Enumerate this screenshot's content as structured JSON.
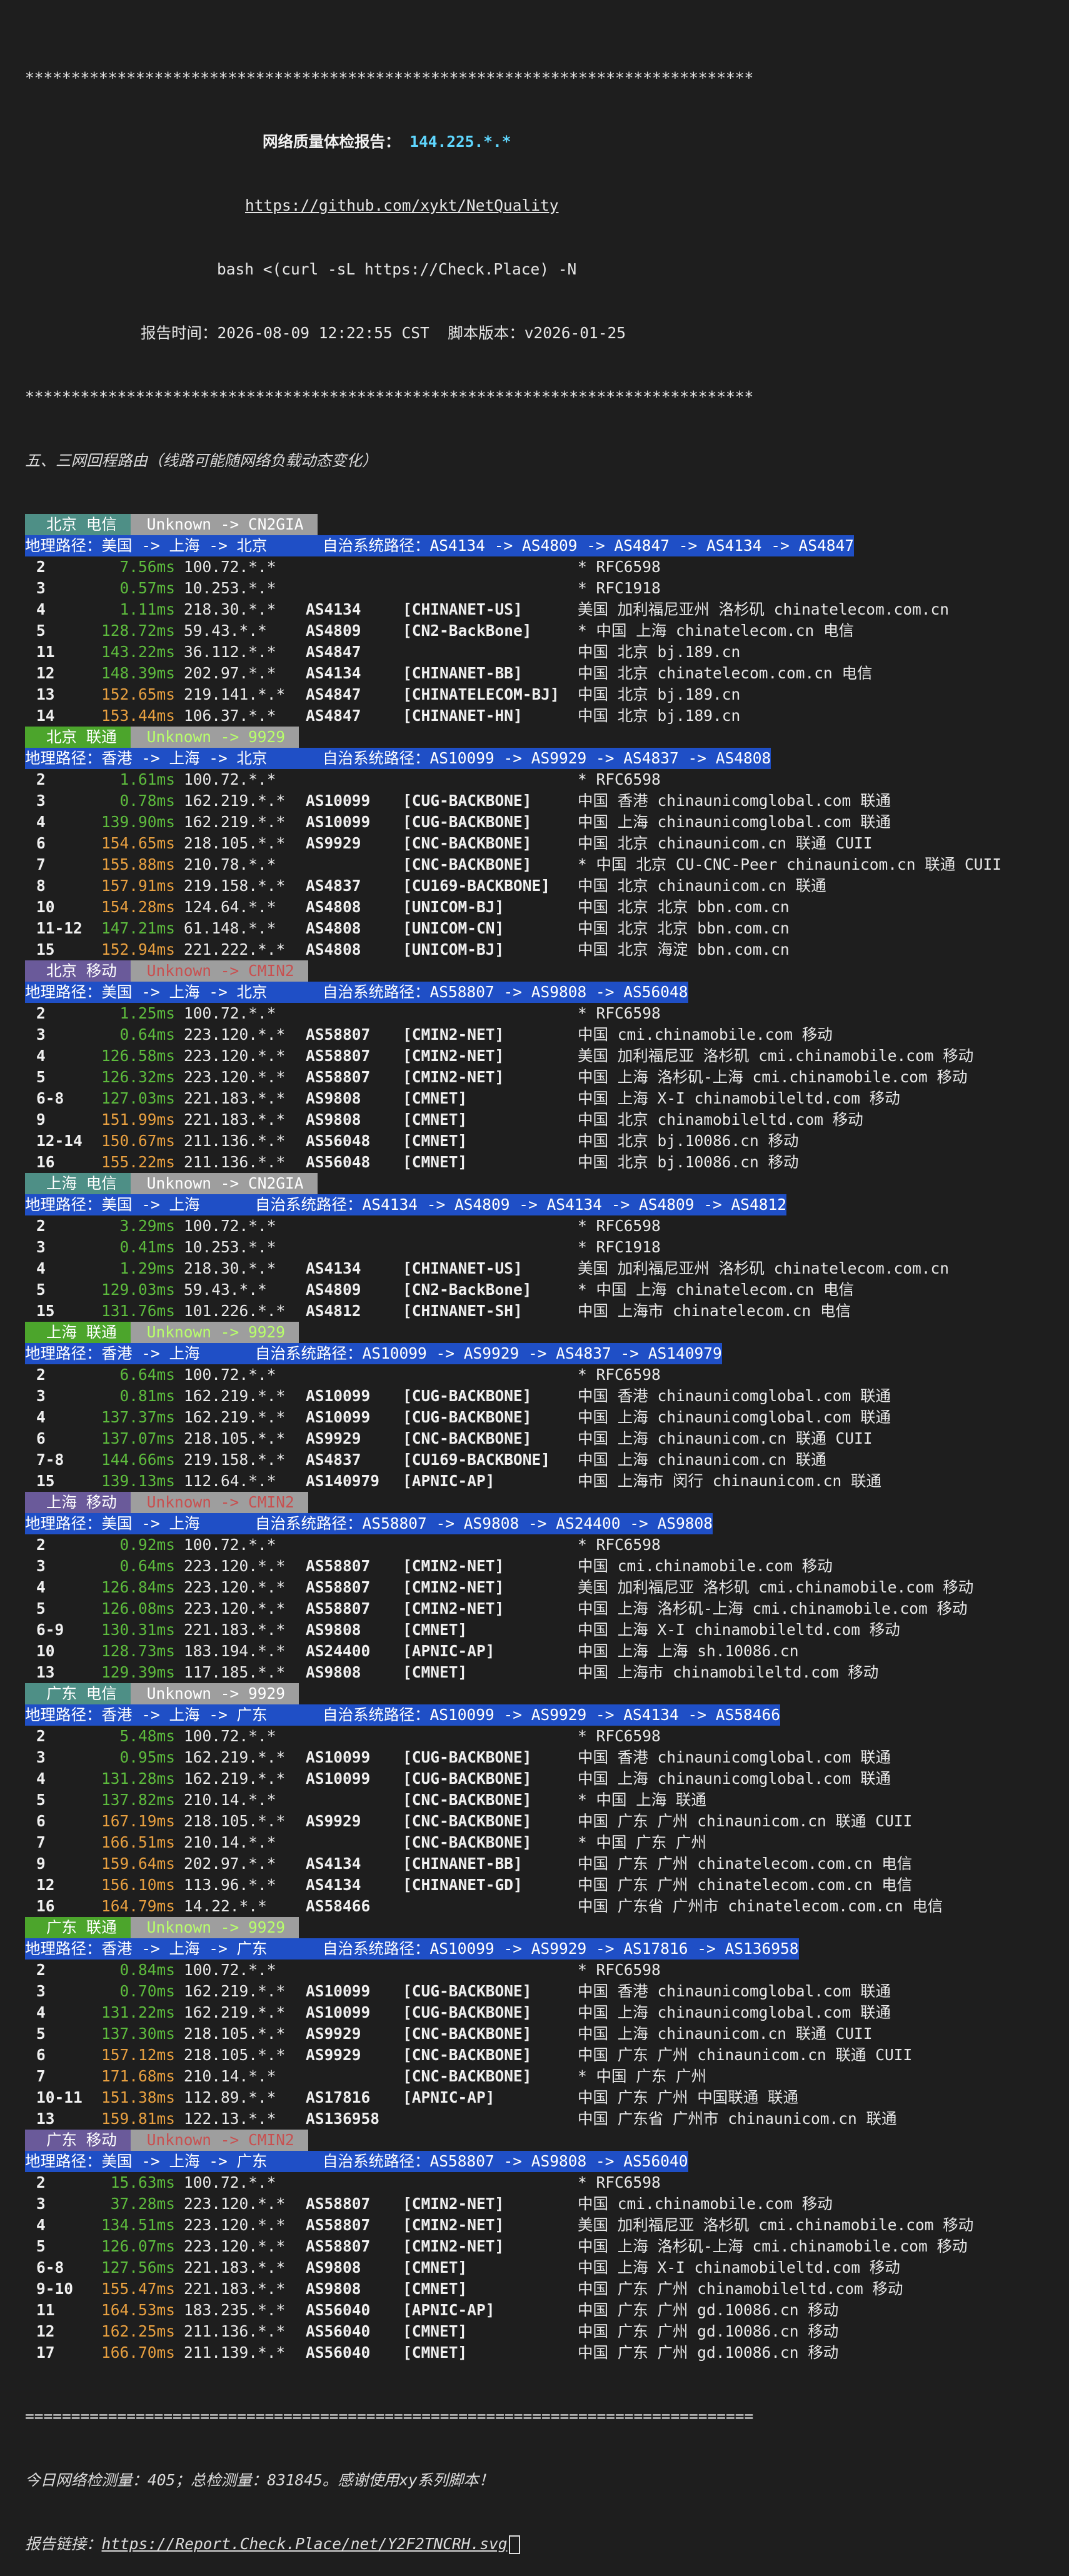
{
  "header": {
    "stars": "*******************************************************************************",
    "title_label": "网络质量体检报告：",
    "title_ip": "144.225.*.*",
    "url": "https://github.com/xykt/NetQuality",
    "command": "bash <(curl -sL https://Check.Place) -N",
    "report_time": "报告时间：2026-08-09 12:22:55 CST  脚本版本：v2026-01-25"
  },
  "section_title": "五、三网回程路由（线路可能随网络负载动态变化）",
  "routes": [
    {
      "city": "北京",
      "isp": "电信",
      "lbl_color": "#4e8f86",
      "tag": "Unknown -> CN2GIA",
      "tag_style": "plain",
      "path": "地理路径：美国 -> 上海 -> 北京      自治系统路径：AS4134 -> AS4809 -> AS4847 -> AS4134 -> AS4847",
      "hops": [
        {
          "hop": "2",
          "ms": "7.56ms",
          "msc": "#5dbb3d",
          "ip": "100.72.*.*",
          "as": "",
          "tag": "",
          "geo": "* RFC6598"
        },
        {
          "hop": "3",
          "ms": "0.57ms",
          "msc": "#5dbb3d",
          "ip": "10.253.*.*",
          "as": "",
          "tag": "",
          "geo": "* RFC1918"
        },
        {
          "hop": "4",
          "ms": "1.11ms",
          "msc": "#5dbb3d",
          "ip": "218.30.*.*",
          "as": "AS4134",
          "tag": "[CHINANET-US]",
          "geo": "美国 加利福尼亚州 洛杉矶 chinatelecom.com.cn"
        },
        {
          "hop": "5",
          "ms": "128.72ms",
          "msc": "#5dbb3d",
          "ip": "59.43.*.*",
          "as": "AS4809",
          "tag": "[CN2-BackBone]",
          "geo": "* 中国 上海 chinatelecom.cn 电信"
        },
        {
          "hop": "11",
          "ms": "143.22ms",
          "msc": "#5dbb3d",
          "ip": "36.112.*.*",
          "as": "AS4847",
          "tag": "",
          "geo": "中国 北京 bj.189.cn"
        },
        {
          "hop": "12",
          "ms": "148.39ms",
          "msc": "#5dbb3d",
          "ip": "202.97.*.*",
          "as": "AS4134",
          "tag": "[CHINANET-BB]",
          "geo": "中国 北京 chinatelecom.com.cn 电信"
        },
        {
          "hop": "13",
          "ms": "152.65ms",
          "msc": "#e8a040",
          "ip": "219.141.*.*",
          "as": "AS4847",
          "tag": "[CHINATELECOM-BJ]",
          "geo": "中国 北京 bj.189.cn"
        },
        {
          "hop": "14",
          "ms": "153.44ms",
          "msc": "#e8a040",
          "ip": "106.37.*.*",
          "as": "AS4847",
          "tag": "[CHINANET-HN]",
          "geo": "中国 北京 bj.189.cn"
        }
      ]
    },
    {
      "city": "北京",
      "isp": "联通",
      "lbl_color": "#4ca52c",
      "tag": "Unknown -> 9929",
      "tag_style": "green",
      "path": "地理路径：香港 -> 上海 -> 北京      自治系统路径：AS10099 -> AS9929 -> AS4837 -> AS4808",
      "hops": [
        {
          "hop": "2",
          "ms": "1.61ms",
          "msc": "#5dbb3d",
          "ip": "100.72.*.*",
          "as": "",
          "tag": "",
          "geo": "* RFC6598"
        },
        {
          "hop": "3",
          "ms": "0.78ms",
          "msc": "#5dbb3d",
          "ip": "162.219.*.*",
          "as": "AS10099",
          "tag": "[CUG-BACKBONE]",
          "geo": "中国 香港 chinaunicomglobal.com 联通"
        },
        {
          "hop": "4",
          "ms": "139.90ms",
          "msc": "#5dbb3d",
          "ip": "162.219.*.*",
          "as": "AS10099",
          "tag": "[CUG-BACKBONE]",
          "geo": "中国 上海 chinaunicomglobal.com 联通"
        },
        {
          "hop": "6",
          "ms": "154.65ms",
          "msc": "#e8a040",
          "ip": "218.105.*.*",
          "as": "AS9929",
          "tag": "[CNC-BACKBONE]",
          "geo": "中国 北京 chinaunicom.cn 联通 CUII"
        },
        {
          "hop": "7",
          "ms": "155.88ms",
          "msc": "#e8a040",
          "ip": "210.78.*.*",
          "as": "",
          "tag": "[CNC-BACKBONE]",
          "geo": "* 中国 北京 CU-CNC-Peer chinaunicom.cn 联通 CUII"
        },
        {
          "hop": "8",
          "ms": "157.91ms",
          "msc": "#e8a040",
          "ip": "219.158.*.*",
          "as": "AS4837",
          "tag": "[CU169-BACKBONE]",
          "geo": "中国 北京 chinaunicom.cn 联通"
        },
        {
          "hop": "10",
          "ms": "154.28ms",
          "msc": "#e8a040",
          "ip": "124.64.*.*",
          "as": "AS4808",
          "tag": "[UNICOM-BJ]",
          "geo": "中国 北京 北京 bbn.com.cn"
        },
        {
          "hop": "11-12",
          "ms": "147.21ms",
          "msc": "#5dbb3d",
          "ip": "61.148.*.*",
          "as": "AS4808",
          "tag": "[UNICOM-CN]",
          "geo": "中国 北京 北京 bbn.com.cn"
        },
        {
          "hop": "15",
          "ms": "152.94ms",
          "msc": "#e8a040",
          "ip": "221.222.*.*",
          "as": "AS4808",
          "tag": "[UNICOM-BJ]",
          "geo": "中国 北京 海淀 bbn.com.cn"
        }
      ]
    },
    {
      "city": "北京",
      "isp": "移动",
      "lbl_color": "#6a5a9a",
      "tag": "Unknown -> CMIN2",
      "tag_style": "red",
      "path": "地理路径：美国 -> 上海 -> 北京      自治系统路径：AS58807 -> AS9808 -> AS56048",
      "hops": [
        {
          "hop": "2",
          "ms": "1.25ms",
          "msc": "#5dbb3d",
          "ip": "100.72.*.*",
          "as": "",
          "tag": "",
          "geo": "* RFC6598"
        },
        {
          "hop": "3",
          "ms": "0.64ms",
          "msc": "#5dbb3d",
          "ip": "223.120.*.*",
          "as": "AS58807",
          "tag": "[CMIN2-NET]",
          "geo": "中国 cmi.chinamobile.com 移动"
        },
        {
          "hop": "4",
          "ms": "126.58ms",
          "msc": "#5dbb3d",
          "ip": "223.120.*.*",
          "as": "AS58807",
          "tag": "[CMIN2-NET]",
          "geo": "美国 加利福尼亚 洛杉矶 cmi.chinamobile.com 移动"
        },
        {
          "hop": "5",
          "ms": "126.32ms",
          "msc": "#5dbb3d",
          "ip": "223.120.*.*",
          "as": "AS58807",
          "tag": "[CMIN2-NET]",
          "geo": "中国 上海 洛杉矶-上海 cmi.chinamobile.com 移动"
        },
        {
          "hop": "6-8",
          "ms": "127.03ms",
          "msc": "#5dbb3d",
          "ip": "221.183.*.*",
          "as": "AS9808",
          "tag": "[CMNET]",
          "geo": "中国 上海 X-I chinamobileltd.com 移动"
        },
        {
          "hop": "9",
          "ms": "151.99ms",
          "msc": "#e8a040",
          "ip": "221.183.*.*",
          "as": "AS9808",
          "tag": "[CMNET]",
          "geo": "中国 北京 chinamobileltd.com 移动"
        },
        {
          "hop": "12-14",
          "ms": "150.67ms",
          "msc": "#e8a040",
          "ip": "211.136.*.*",
          "as": "AS56048",
          "tag": "[CMNET]",
          "geo": "中国 北京 bj.10086.cn 移动"
        },
        {
          "hop": "16",
          "ms": "155.22ms",
          "msc": "#e8a040",
          "ip": "211.136.*.*",
          "as": "AS56048",
          "tag": "[CMNET]",
          "geo": "中国 北京 bj.10086.cn 移动"
        }
      ]
    },
    {
      "city": "上海",
      "isp": "电信",
      "lbl_color": "#4e8f86",
      "tag": "Unknown -> CN2GIA",
      "tag_style": "plain",
      "path": "地理路径：美国 -> 上海      自治系统路径：AS4134 -> AS4809 -> AS4134 -> AS4809 -> AS4812",
      "hops": [
        {
          "hop": "2",
          "ms": "3.29ms",
          "msc": "#5dbb3d",
          "ip": "100.72.*.*",
          "as": "",
          "tag": "",
          "geo": "* RFC6598"
        },
        {
          "hop": "3",
          "ms": "0.41ms",
          "msc": "#5dbb3d",
          "ip": "10.253.*.*",
          "as": "",
          "tag": "",
          "geo": "* RFC1918"
        },
        {
          "hop": "4",
          "ms": "1.29ms",
          "msc": "#5dbb3d",
          "ip": "218.30.*.*",
          "as": "AS4134",
          "tag": "[CHINANET-US]",
          "geo": "美国 加利福尼亚州 洛杉矶 chinatelecom.com.cn"
        },
        {
          "hop": "5",
          "ms": "129.03ms",
          "msc": "#5dbb3d",
          "ip": "59.43.*.*",
          "as": "AS4809",
          "tag": "[CN2-BackBone]",
          "geo": "* 中国 上海 chinatelecom.cn 电信"
        },
        {
          "hop": "15",
          "ms": "131.76ms",
          "msc": "#5dbb3d",
          "ip": "101.226.*.*",
          "as": "AS4812",
          "tag": "[CHINANET-SH]",
          "geo": "中国 上海市 chinatelecom.cn 电信"
        }
      ]
    },
    {
      "city": "上海",
      "isp": "联通",
      "lbl_color": "#4ca52c",
      "tag": "Unknown -> 9929",
      "tag_style": "green",
      "path": "地理路径：香港 -> 上海      自治系统路径：AS10099 -> AS9929 -> AS4837 -> AS140979",
      "hops": [
        {
          "hop": "2",
          "ms": "6.64ms",
          "msc": "#5dbb3d",
          "ip": "100.72.*.*",
          "as": "",
          "tag": "",
          "geo": "* RFC6598"
        },
        {
          "hop": "3",
          "ms": "0.81ms",
          "msc": "#5dbb3d",
          "ip": "162.219.*.*",
          "as": "AS10099",
          "tag": "[CUG-BACKBONE]",
          "geo": "中国 香港 chinaunicomglobal.com 联通"
        },
        {
          "hop": "4",
          "ms": "137.37ms",
          "msc": "#5dbb3d",
          "ip": "162.219.*.*",
          "as": "AS10099",
          "tag": "[CUG-BACKBONE]",
          "geo": "中国 上海 chinaunicomglobal.com 联通"
        },
        {
          "hop": "6",
          "ms": "137.07ms",
          "msc": "#5dbb3d",
          "ip": "218.105.*.*",
          "as": "AS9929",
          "tag": "[CNC-BACKBONE]",
          "geo": "中国 上海 chinaunicom.cn 联通 CUII"
        },
        {
          "hop": "7-8",
          "ms": "144.66ms",
          "msc": "#5dbb3d",
          "ip": "219.158.*.*",
          "as": "AS4837",
          "tag": "[CU169-BACKBONE]",
          "geo": "中国 上海 chinaunicom.cn 联通"
        },
        {
          "hop": "15",
          "ms": "139.13ms",
          "msc": "#5dbb3d",
          "ip": "112.64.*.*",
          "as": "AS140979",
          "tag": "[APNIC-AP]",
          "geo": "中国 上海市 闵行 chinaunicom.cn 联通"
        }
      ]
    },
    {
      "city": "上海",
      "isp": "移动",
      "lbl_color": "#6a5a9a",
      "tag": "Unknown -> CMIN2",
      "tag_style": "red",
      "path": "地理路径：美国 -> 上海      自治系统路径：AS58807 -> AS9808 -> AS24400 -> AS9808",
      "hops": [
        {
          "hop": "2",
          "ms": "0.92ms",
          "msc": "#5dbb3d",
          "ip": "100.72.*.*",
          "as": "",
          "tag": "",
          "geo": "* RFC6598"
        },
        {
          "hop": "3",
          "ms": "0.64ms",
          "msc": "#5dbb3d",
          "ip": "223.120.*.*",
          "as": "AS58807",
          "tag": "[CMIN2-NET]",
          "geo": "中国 cmi.chinamobile.com 移动"
        },
        {
          "hop": "4",
          "ms": "126.84ms",
          "msc": "#5dbb3d",
          "ip": "223.120.*.*",
          "as": "AS58807",
          "tag": "[CMIN2-NET]",
          "geo": "美国 加利福尼亚 洛杉矶 cmi.chinamobile.com 移动"
        },
        {
          "hop": "5",
          "ms": "126.08ms",
          "msc": "#5dbb3d",
          "ip": "223.120.*.*",
          "as": "AS58807",
          "tag": "[CMIN2-NET]",
          "geo": "中国 上海 洛杉矶-上海 cmi.chinamobile.com 移动"
        },
        {
          "hop": "6-9",
          "ms": "130.31ms",
          "msc": "#5dbb3d",
          "ip": "221.183.*.*",
          "as": "AS9808",
          "tag": "[CMNET]",
          "geo": "中国 上海 X-I chinamobileltd.com 移动"
        },
        {
          "hop": "10",
          "ms": "128.73ms",
          "msc": "#5dbb3d",
          "ip": "183.194.*.*",
          "as": "AS24400",
          "tag": "[APNIC-AP]",
          "geo": "中国 上海 上海 sh.10086.cn"
        },
        {
          "hop": "13",
          "ms": "129.39ms",
          "msc": "#5dbb3d",
          "ip": "117.185.*.*",
          "as": "AS9808",
          "tag": "[CMNET]",
          "geo": "中国 上海市 chinamobileltd.com 移动"
        }
      ]
    },
    {
      "city": "广东",
      "isp": "电信",
      "lbl_color": "#4e8f86",
      "tag": "Unknown -> 9929",
      "tag_style": "plain",
      "path": "地理路径：香港 -> 上海 -> 广东      自治系统路径：AS10099 -> AS9929 -> AS4134 -> AS58466",
      "hops": [
        {
          "hop": "2",
          "ms": "5.48ms",
          "msc": "#5dbb3d",
          "ip": "100.72.*.*",
          "as": "",
          "tag": "",
          "geo": "* RFC6598"
        },
        {
          "hop": "3",
          "ms": "0.95ms",
          "msc": "#5dbb3d",
          "ip": "162.219.*.*",
          "as": "AS10099",
          "tag": "[CUG-BACKBONE]",
          "geo": "中国 香港 chinaunicomglobal.com 联通"
        },
        {
          "hop": "4",
          "ms": "131.28ms",
          "msc": "#5dbb3d",
          "ip": "162.219.*.*",
          "as": "AS10099",
          "tag": "[CUG-BACKBONE]",
          "geo": "中国 上海 chinaunicomglobal.com 联通"
        },
        {
          "hop": "5",
          "ms": "137.82ms",
          "msc": "#5dbb3d",
          "ip": "210.14.*.*",
          "as": "",
          "tag": "[CNC-BACKBONE]",
          "geo": "* 中国 上海 联通"
        },
        {
          "hop": "6",
          "ms": "167.19ms",
          "msc": "#e8a040",
          "ip": "218.105.*.*",
          "as": "AS9929",
          "tag": "[CNC-BACKBONE]",
          "geo": "中国 广东 广州 chinaunicom.cn 联通 CUII"
        },
        {
          "hop": "7",
          "ms": "166.51ms",
          "msc": "#e8a040",
          "ip": "210.14.*.*",
          "as": "",
          "tag": "[CNC-BACKBONE]",
          "geo": "* 中国 广东 广州"
        },
        {
          "hop": "9",
          "ms": "159.64ms",
          "msc": "#e8a040",
          "ip": "202.97.*.*",
          "as": "AS4134",
          "tag": "[CHINANET-BB]",
          "geo": "中国 广东 广州 chinatelecom.com.cn 电信"
        },
        {
          "hop": "12",
          "ms": "156.10ms",
          "msc": "#e8a040",
          "ip": "113.96.*.*",
          "as": "AS4134",
          "tag": "[CHINANET-GD]",
          "geo": "中国 广东 广州 chinatelecom.com.cn 电信"
        },
        {
          "hop": "16",
          "ms": "164.79ms",
          "msc": "#e8a040",
          "ip": "14.22.*.*",
          "as": "AS58466",
          "tag": "",
          "geo": "中国 广东省 广州市 chinatelecom.com.cn 电信"
        }
      ]
    },
    {
      "city": "广东",
      "isp": "联通",
      "lbl_color": "#4ca52c",
      "tag": "Unknown -> 9929",
      "tag_style": "green",
      "path": "地理路径：香港 -> 上海 -> 广东      自治系统路径：AS10099 -> AS9929 -> AS17816 -> AS136958",
      "hops": [
        {
          "hop": "2",
          "ms": "0.84ms",
          "msc": "#5dbb3d",
          "ip": "100.72.*.*",
          "as": "",
          "tag": "",
          "geo": "* RFC6598"
        },
        {
          "hop": "3",
          "ms": "0.70ms",
          "msc": "#5dbb3d",
          "ip": "162.219.*.*",
          "as": "AS10099",
          "tag": "[CUG-BACKBONE]",
          "geo": "中国 香港 chinaunicomglobal.com 联通"
        },
        {
          "hop": "4",
          "ms": "131.22ms",
          "msc": "#5dbb3d",
          "ip": "162.219.*.*",
          "as": "AS10099",
          "tag": "[CUG-BACKBONE]",
          "geo": "中国 上海 chinaunicomglobal.com 联通"
        },
        {
          "hop": "5",
          "ms": "137.30ms",
          "msc": "#5dbb3d",
          "ip": "218.105.*.*",
          "as": "AS9929",
          "tag": "[CNC-BACKBONE]",
          "geo": "中国 上海 chinaunicom.cn 联通 CUII"
        },
        {
          "hop": "6",
          "ms": "157.12ms",
          "msc": "#e8a040",
          "ip": "218.105.*.*",
          "as": "AS9929",
          "tag": "[CNC-BACKBONE]",
          "geo": "中国 广东 广州 chinaunicom.cn 联通 CUII"
        },
        {
          "hop": "7",
          "ms": "171.68ms",
          "msc": "#e8a040",
          "ip": "210.14.*.*",
          "as": "",
          "tag": "[CNC-BACKBONE]",
          "geo": "* 中国 广东 广州"
        },
        {
          "hop": "10-11",
          "ms": "151.38ms",
          "msc": "#e8a040",
          "ip": "112.89.*.*",
          "as": "AS17816",
          "tag": "[APNIC-AP]",
          "geo": "中国 广东 广州 中国联通 联通"
        },
        {
          "hop": "13",
          "ms": "159.81ms",
          "msc": "#e8a040",
          "ip": "122.13.*.*",
          "as": "AS136958",
          "tag": "",
          "geo": "中国 广东省 广州市 chinaunicom.cn 联通"
        }
      ]
    },
    {
      "city": "广东",
      "isp": "移动",
      "lbl_color": "#6a5a9a",
      "tag": "Unknown -> CMIN2",
      "tag_style": "red",
      "path": "地理路径：美国 -> 上海 -> 广东      自治系统路径：AS58807 -> AS9808 -> AS56040",
      "hops": [
        {
          "hop": "2",
          "ms": "15.63ms",
          "msc": "#5dbb3d",
          "ip": "100.72.*.*",
          "as": "",
          "tag": "",
          "geo": "* RFC6598"
        },
        {
          "hop": "3",
          "ms": "37.28ms",
          "msc": "#5dbb3d",
          "ip": "223.120.*.*",
          "as": "AS58807",
          "tag": "[CMIN2-NET]",
          "geo": "中国 cmi.chinamobile.com 移动"
        },
        {
          "hop": "4",
          "ms": "134.51ms",
          "msc": "#5dbb3d",
          "ip": "223.120.*.*",
          "as": "AS58807",
          "tag": "[CMIN2-NET]",
          "geo": "美国 加利福尼亚 洛杉矶 cmi.chinamobile.com 移动"
        },
        {
          "hop": "5",
          "ms": "126.07ms",
          "msc": "#5dbb3d",
          "ip": "223.120.*.*",
          "as": "AS58807",
          "tag": "[CMIN2-NET]",
          "geo": "中国 上海 洛杉矶-上海 cmi.chinamobile.com 移动"
        },
        {
          "hop": "6-8",
          "ms": "127.56ms",
          "msc": "#5dbb3d",
          "ip": "221.183.*.*",
          "as": "AS9808",
          "tag": "[CMNET]",
          "geo": "中国 上海 X-I chinamobileltd.com 移动"
        },
        {
          "hop": "9-10",
          "ms": "155.47ms",
          "msc": "#e8a040",
          "ip": "221.183.*.*",
          "as": "AS9808",
          "tag": "[CMNET]",
          "geo": "中国 广东 广州 chinamobileltd.com 移动"
        },
        {
          "hop": "11",
          "ms": "164.53ms",
          "msc": "#e8a040",
          "ip": "183.235.*.*",
          "as": "AS56040",
          "tag": "[APNIC-AP]",
          "geo": "中国 广东 广州 gd.10086.cn 移动"
        },
        {
          "hop": "12",
          "ms": "162.25ms",
          "msc": "#e8a040",
          "ip": "211.136.*.*",
          "as": "AS56040",
          "tag": "[CMNET]",
          "geo": "中国 广东 广州 gd.10086.cn 移动"
        },
        {
          "hop": "17",
          "ms": "166.70ms",
          "msc": "#e8a040",
          "ip": "211.139.*.*",
          "as": "AS56040",
          "tag": "[CMNET]",
          "geo": "中国 广东 广州 gd.10086.cn 移动"
        }
      ]
    }
  ],
  "footer": {
    "equals": "===============================================================================",
    "stats": "今日网络检测量：405；总检测量：831845。感谢使用xy系列脚本！",
    "link_label": "报告链接：",
    "link_url": "https://Report.Check.Place/net/Y2F2TNCRH.svg"
  }
}
